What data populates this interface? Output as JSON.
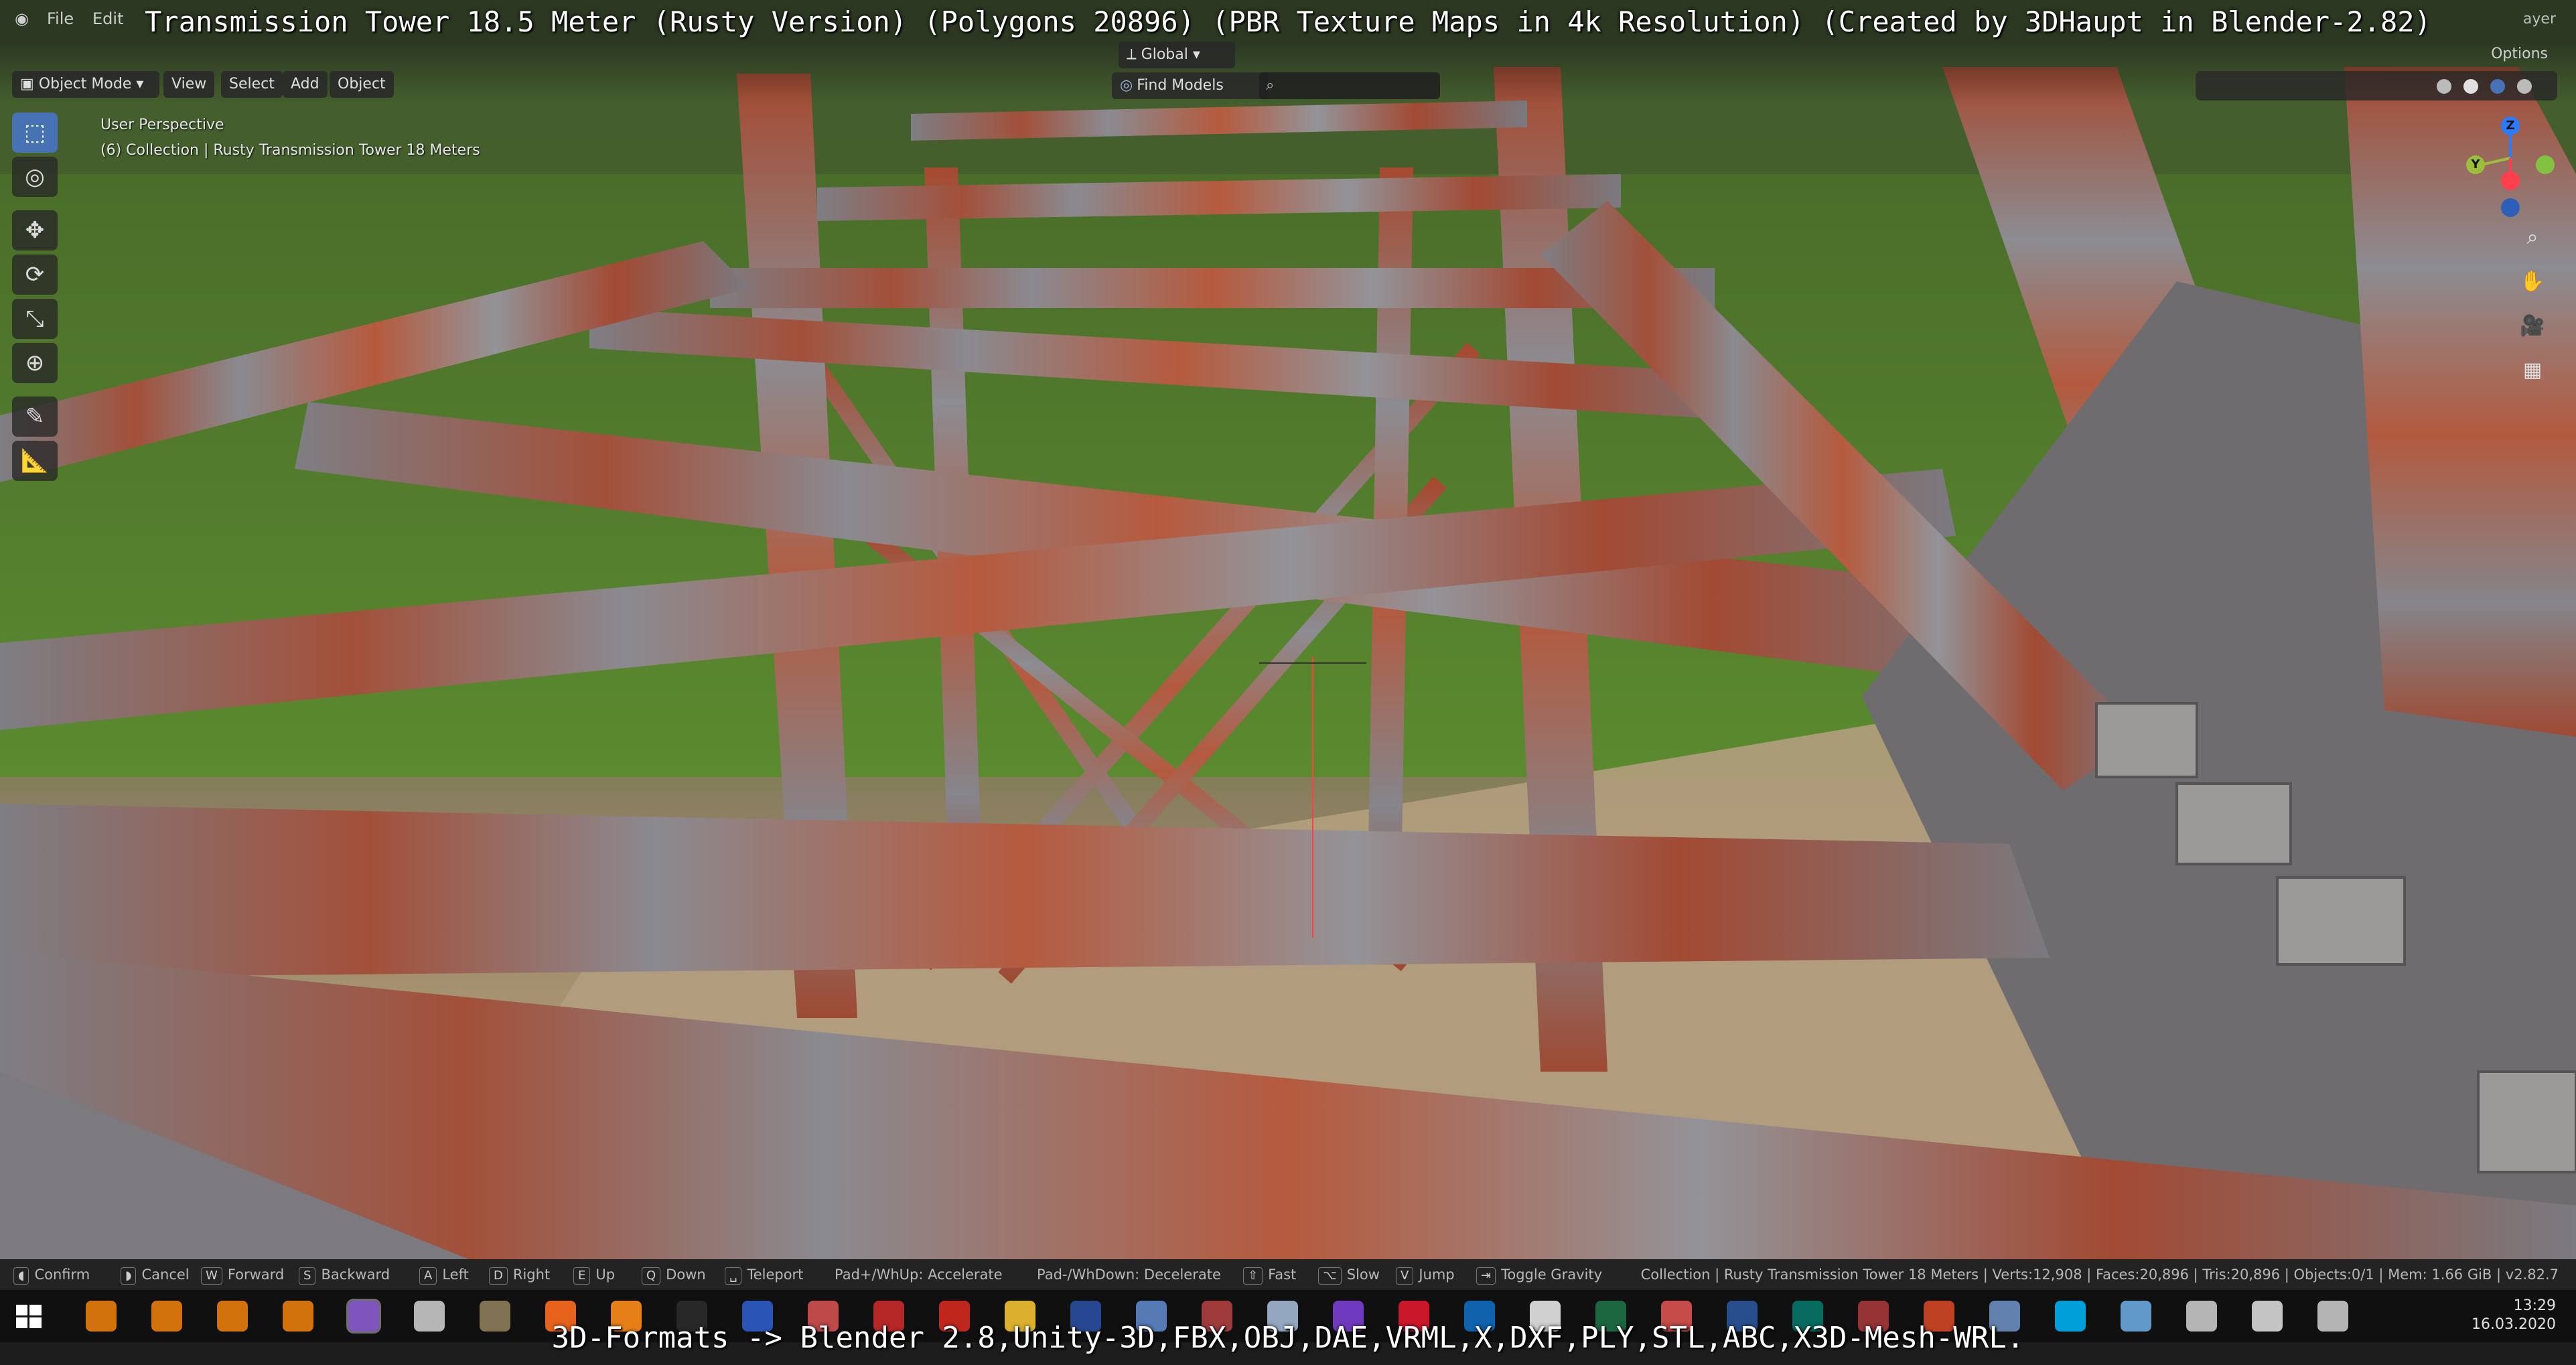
{
  "banner_top": "Transmission Tower 18.5 Meter (Rusty Version) (Polygons 20896) (PBR Texture Maps in 4k Resolution) (Created by 3DHaupt in Blender-2.82)",
  "banner_bottom": "3D-Formats -> Blender 2.8,Unity-3D,FBX,OBJ,DAE,VRML,X,DXF,PLY,STL,ABC,X3D-Mesh-WRL.",
  "menubar": {
    "items": [
      "File",
      "Edit"
    ],
    "right_text": "ayer"
  },
  "header": {
    "mode": "Object Mode",
    "menus": [
      "View",
      "Select",
      "Add",
      "Object"
    ],
    "orientation": "Global",
    "find_models": "Find Models",
    "options": "Options"
  },
  "viewport": {
    "perspective": "User Perspective",
    "collection": "(6) Collection | Rusty Transmission Tower 18 Meters"
  },
  "gizmo": {
    "z": "Z",
    "y": "Y",
    "x": "X"
  },
  "toolbar": {
    "tools": [
      {
        "name": "select-box-icon",
        "glyph": "⬚"
      },
      {
        "name": "cursor-icon",
        "glyph": "◎"
      },
      {
        "name": "move-icon",
        "glyph": "✥"
      },
      {
        "name": "rotate-icon",
        "glyph": "⟳"
      },
      {
        "name": "scale-icon",
        "glyph": "⤡"
      },
      {
        "name": "transform-icon",
        "glyph": "⊕"
      },
      {
        "name": "annotate-icon",
        "glyph": "✎"
      },
      {
        "name": "measure-icon",
        "glyph": "📐"
      }
    ]
  },
  "statusbar": {
    "hints": [
      {
        "key": "",
        "label": "Confirm"
      },
      {
        "key": "",
        "label": "Cancel"
      },
      {
        "key": "W",
        "label": "Forward"
      },
      {
        "key": "S",
        "label": "Backward"
      },
      {
        "key": "A",
        "label": "Left"
      },
      {
        "key": "D",
        "label": "Right"
      },
      {
        "key": "E",
        "label": "Up"
      },
      {
        "key": "Q",
        "label": "Down"
      },
      {
        "key": "",
        "label": "Teleport"
      },
      {
        "key": "",
        "label": "Pad+/WhUp: Accelerate"
      },
      {
        "key": "",
        "label": "Pad-/WhDown: Decelerate"
      },
      {
        "key": "",
        "label": "Fast"
      },
      {
        "key": "",
        "label": "Slow"
      },
      {
        "key": "V",
        "label": "Jump"
      },
      {
        "key": "",
        "label": "Toggle Gravity"
      }
    ],
    "scene_stats": "Collection | Rusty Transmission Tower 18 Meters | Verts:12,908 | Faces:20,896 | Tris:20,896 | Objects:0/1 | Mem: 1.66 GiB | v2.82.7"
  },
  "taskbar": {
    "time": "13:29",
    "date": "16.03.2020",
    "icons": [
      {
        "name": "blender-icon",
        "color": "#e87d0d"
      },
      {
        "name": "blender-icon",
        "color": "#e87d0d"
      },
      {
        "name": "blender-icon",
        "color": "#e87d0d"
      },
      {
        "name": "blender-icon",
        "color": "#e87d0d"
      },
      {
        "name": "blender-icon",
        "color": "#8a5cd0"
      },
      {
        "name": "unity-icon",
        "color": "#c9c9c9"
      },
      {
        "name": "gimp-icon",
        "color": "#8f7d5c"
      },
      {
        "name": "firefox-icon",
        "color": "#ff6d1f"
      },
      {
        "name": "flame-icon",
        "color": "#ff8c1a"
      },
      {
        "name": "terminal-icon",
        "color": "#2b2b2b"
      },
      {
        "name": "save-icon",
        "color": "#2d5cc9"
      },
      {
        "name": "network-icon",
        "color": "#d05050"
      },
      {
        "name": "bug-icon",
        "color": "#c92a2a"
      },
      {
        "name": "pdf-icon",
        "color": "#d42a1e"
      },
      {
        "name": "folder-icon",
        "color": "#f1c232"
      },
      {
        "name": "xnview-icon",
        "color": "#2a4fa0"
      },
      {
        "name": "chart-icon",
        "color": "#5d86c7"
      },
      {
        "name": "tool-icon",
        "color": "#b04040"
      },
      {
        "name": "paper-icon",
        "color": "#a3b8d4"
      },
      {
        "name": "gem-icon",
        "color": "#7b3fd1"
      },
      {
        "name": "opera-icon",
        "color": "#e0182d"
      },
      {
        "name": "outlook-icon",
        "color": "#0f6cbd"
      },
      {
        "name": "edge-icon",
        "color": "#e6e6e6"
      },
      {
        "name": "excel-icon",
        "color": "#1e7145"
      },
      {
        "name": "vector-icon",
        "color": "#d9534f"
      },
      {
        "name": "word-icon",
        "color": "#2b579a"
      },
      {
        "name": "publisher-icon",
        "color": "#077568"
      },
      {
        "name": "access-icon",
        "color": "#a4373a"
      },
      {
        "name": "powerpoint-icon",
        "color": "#d24726"
      },
      {
        "name": "image-icon",
        "color": "#6c8ebf"
      },
      {
        "name": "skype-icon",
        "color": "#00aff0"
      },
      {
        "name": "pen-icon",
        "color": "#6aa9e0"
      },
      {
        "name": "paint-icon",
        "color": "#c8c8c8"
      },
      {
        "name": "unity-hub-icon",
        "color": "#d8d8d8"
      },
      {
        "name": "steam-icon",
        "color": "#c7c7c7"
      }
    ]
  },
  "colors": {
    "accent": "#4772b3",
    "rust": "#a5482e",
    "steel": "#8d8d92"
  }
}
